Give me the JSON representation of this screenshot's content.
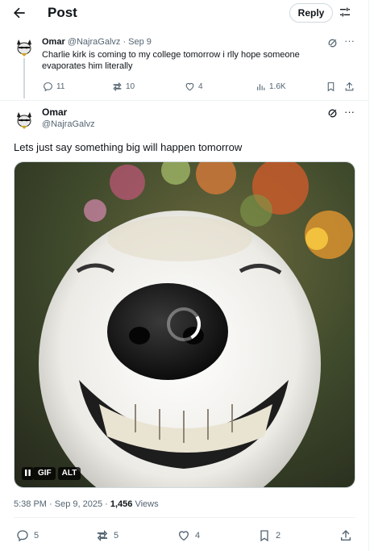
{
  "colors": {
    "text": "#0f1419",
    "secondary": "#536471",
    "border": "#cfd9de"
  },
  "header": {
    "title": "Post",
    "reply_label": "Reply",
    "back_icon": "arrow-left-icon",
    "tune_icon": "sliders-icon"
  },
  "parent_tweet": {
    "name": "Omar",
    "handle": "@NajraGalvz",
    "date": "· Sep 9",
    "text": "Charlie kirk is coming to my college tomorrow i rlly hope someone evaporates him literally",
    "actions": {
      "replies": "11",
      "reposts": "10",
      "likes": "4",
      "views": "1.6K"
    }
  },
  "main_tweet": {
    "name": "Omar",
    "handle": "@NajraGalvz",
    "text": "Lets just say something big will happen tomorrow",
    "media": {
      "badge_gif": "GIF",
      "badge_alt": "ALT",
      "pause_icon": "pause-icon"
    },
    "timestamp": "5:38 PM · Sep 9, 2025 · ",
    "views_count": "1,456",
    "views_label": " Views",
    "actions": {
      "replies": "5",
      "reposts": "5",
      "likes": "4",
      "bookmarks": "2"
    }
  }
}
